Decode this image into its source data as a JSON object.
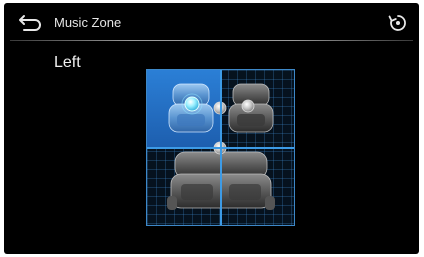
{
  "header": {
    "title": "Music Zone",
    "back_icon": "back-arrow-icon",
    "reset_icon": "reset-icon"
  },
  "zone": {
    "current_label": "Left",
    "zones": [
      {
        "id": "front-left",
        "selected": true
      },
      {
        "id": "front-right",
        "selected": false
      },
      {
        "id": "rear",
        "selected": false
      }
    ]
  },
  "colors": {
    "selected_zone": "#2b7fd6",
    "grid_line": "#3d9be6",
    "background": "#000000"
  }
}
